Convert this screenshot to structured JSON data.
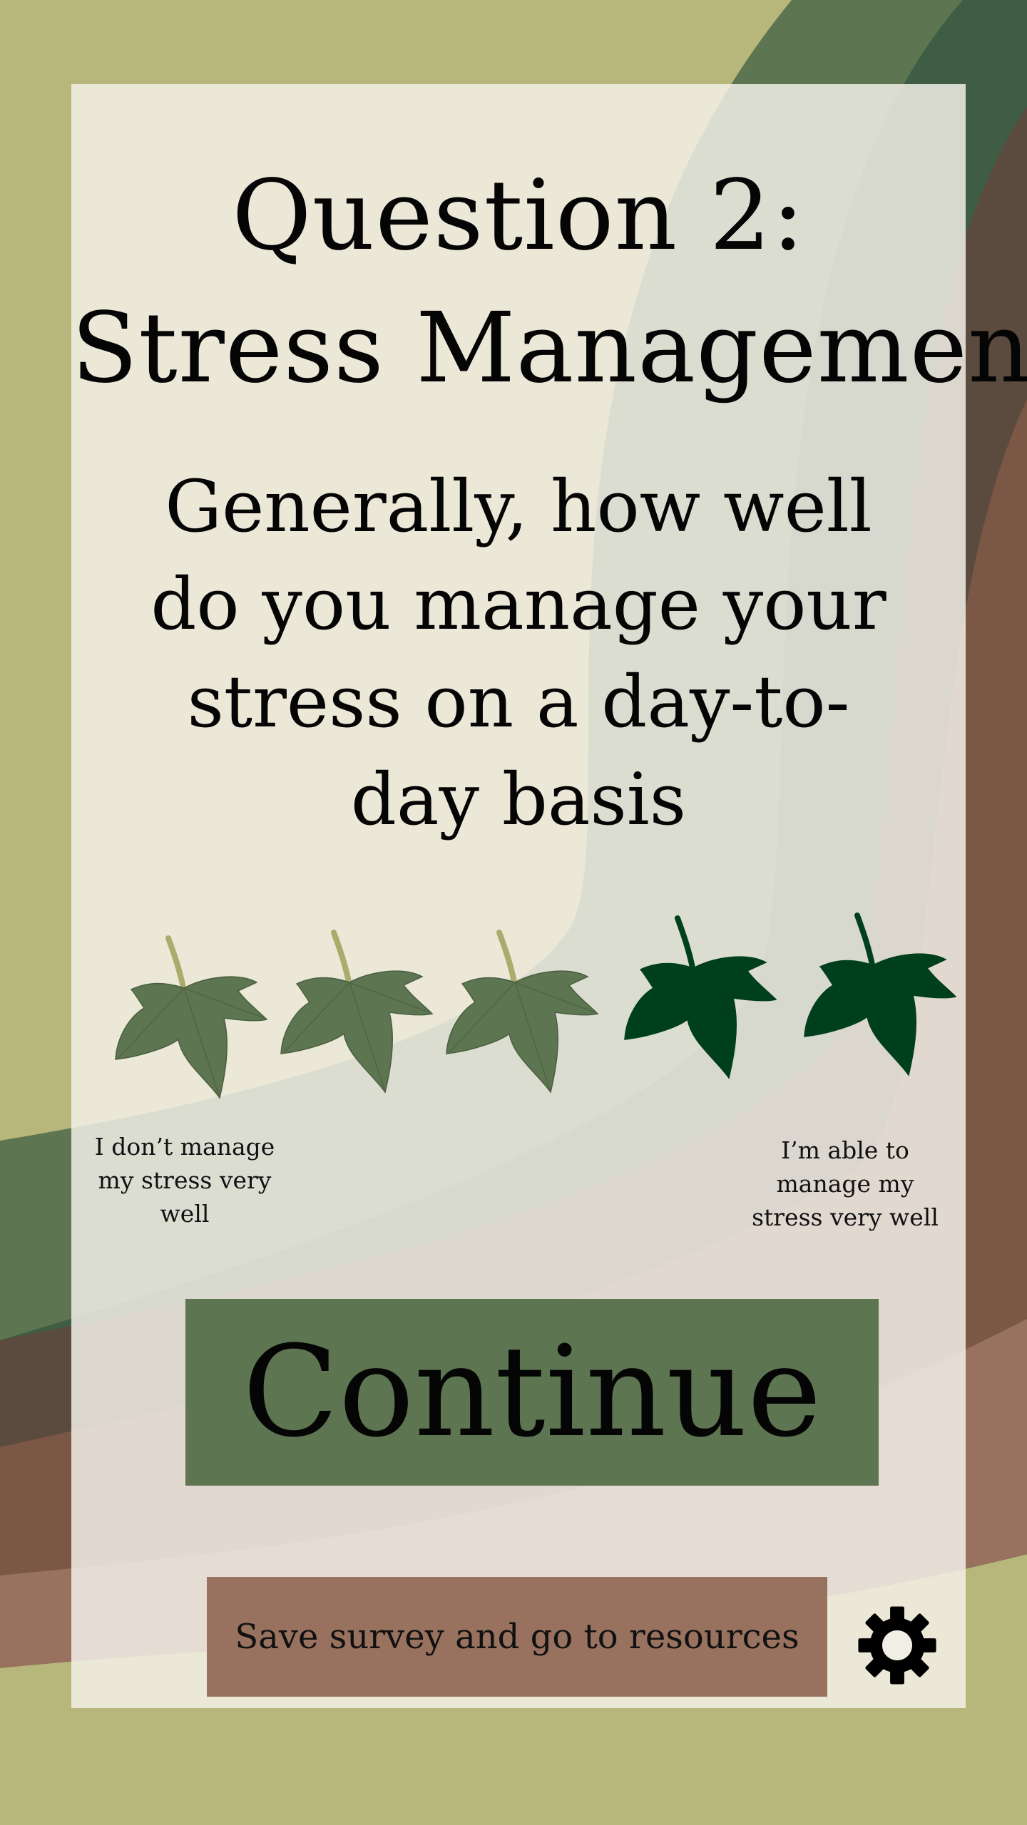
{
  "survey": {
    "title_line1": "Question 2:",
    "title_line2": "Stress Management",
    "question": "Generally, how well do you manage your stress on a day-to-day basis",
    "rating": {
      "selected": 3,
      "max": 5
    },
    "scale_low_label": "I don’t manage my stress very well",
    "scale_high_label": "I’m able to manage my stress very well",
    "continue_label": "Continue",
    "save_label": "Save survey and go to resources"
  },
  "icons": {
    "rating": "leaf-icon",
    "settings": "gear-icon"
  },
  "colors": {
    "background": "#b7b77c",
    "leaf_selected": "#5d7551",
    "leaf_unselected": "#003f1c",
    "continue_button": "#5d7551",
    "save_button": "#98725e"
  }
}
